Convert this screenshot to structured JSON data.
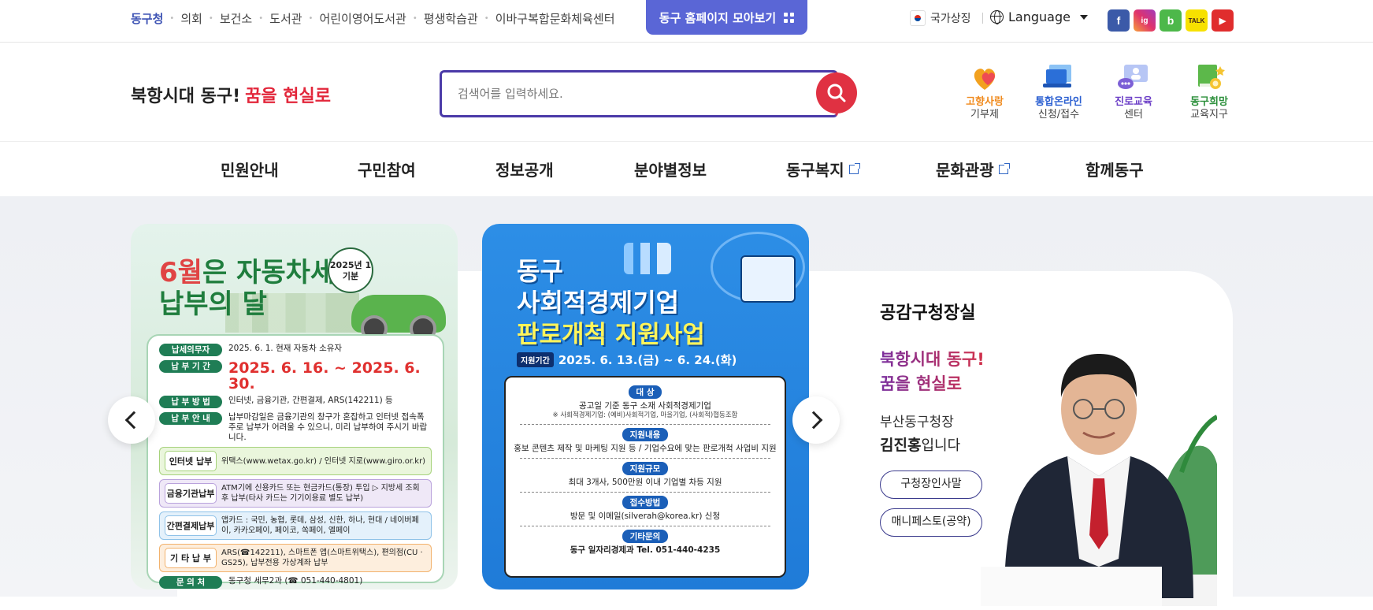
{
  "topbar": {
    "links": [
      "동구청",
      "의회",
      "보건소",
      "도서관",
      "어린이영어도서관",
      "평생학습관",
      "이바구복합문화체육센터"
    ],
    "all_sites_button": "동구 홈페이지 모아보기",
    "national_symbol": "국가상징",
    "language": "Language",
    "social": [
      "f",
      "ig",
      "b",
      "TALK",
      "▶"
    ]
  },
  "header": {
    "slogan_black": "북항시대 동구!",
    "slogan_red": "꿈을 현실로",
    "search_placeholder": "검색어를 입력하세요.",
    "quick_links": [
      {
        "title": "고향사랑",
        "sub": "기부제",
        "color": "#f08a1d"
      },
      {
        "title": "통합온라인",
        "sub": "신청/접수",
        "color": "#2b5fd1"
      },
      {
        "title": "진로교육",
        "sub": "센터",
        "color": "#6c3fc7"
      },
      {
        "title": "동구희망",
        "sub": "교육지구",
        "color": "#2b8f3a"
      }
    ]
  },
  "gnb": [
    "민원안내",
    "구민참여",
    "정보공개",
    "분야별정보",
    "동구복지",
    "문화관광",
    "함께동구"
  ],
  "slider": {
    "poster1": {
      "badge": "2025년 1기분",
      "title_red": "6월",
      "title_rest": "은 자동차세",
      "title_line2": "납부의 달",
      "rows": [
        {
          "label": "납세의무자",
          "text": "2025. 6. 1. 현재 자동차 소유자"
        },
        {
          "label": "납 부 기 간",
          "text": "2025. 6. 16. ~ 2025. 6. 30."
        },
        {
          "label": "납 부 방 법",
          "text": "인터넷, 금융기관, 간편결제, ARS(142211) 등"
        },
        {
          "label": "납 부 안 내",
          "text": "납부마감일은 금융기관의 창구가 혼잡하고 인터넷 접속폭주로 납부가 어려울 수 있으니, 미리 납부하여 주시기 바랍니다."
        }
      ],
      "subs": [
        {
          "tag": "인터넷 납부",
          "text": "위택스(www.wetax.go.kr) / 인터넷 지로(www.giro.or.kr)",
          "bg": "#eaf6dc",
          "border": "#a6d27b"
        },
        {
          "tag": "금융기관납부",
          "text": "ATM기에 신용카드 또는 현금카드(통장) 투입 ▷ 지방세 조회 후 납부(타사 카드는 기기이용료 별도 납부)",
          "bg": "#efe8f7",
          "border": "#b9a2dc"
        },
        {
          "tag": "간편결제납부",
          "text": "앱카드 : 국민, 농협, 롯데, 삼성, 신한, 하나, 현대 / 네이버페이, 카카오페이, 페이코, 쏙페이, 엘페이",
          "bg": "#e4f1fb",
          "border": "#8fc2e8"
        },
        {
          "tag": "기 타 납 부",
          "text": "ARS(☎142211), 스마트폰 앱(스마트위택스), 편의점(CU · GS25), 납부전용 가상계좌 납부",
          "bg": "#fdeedd",
          "border": "#f2b26d"
        }
      ],
      "contact_label": "문 의 처",
      "contact_text": "동구청 세무2과 (☎ 051-440-4801)"
    },
    "poster2": {
      "title_line1": "동구",
      "title_line2": "사회적경제기업",
      "title_line3": "판로개척 지원사업",
      "period_label": "지원기간",
      "period": "2025. 6. 13.(금) ~ 6. 24.(화)",
      "sections": [
        {
          "tag": "대 상",
          "text": "공고일 기준 동구 소재 사회적경제기업",
          "small": "※ 사회적경제기업: (예비)사회적기업, 마을기업, (사회적)협동조합"
        },
        {
          "tag": "지원내용",
          "text": "홍보 콘텐츠 제작 및 마케팅 지원 등 / 기업수요에 맞는 판로개척 사업비 지원",
          "small": ""
        },
        {
          "tag": "지원규모",
          "text": "최대 3개사, 500만원 이내 기업별 차등 지원",
          "small": ""
        },
        {
          "tag": "접수방법",
          "text": "방문 및 이메일(silverah@korea.kr) 신청",
          "small": ""
        },
        {
          "tag": "기타문의",
          "text": "동구 일자리경제과 Tel. 051-440-4235",
          "small": ""
        }
      ]
    }
  },
  "mayor": {
    "title": "공감구청장실",
    "slogan_line1": "북항시대 동구!",
    "slogan_line2": "꿈을 현실로",
    "role": "부산동구청장",
    "name": "김진홍",
    "name_suffix": "입니다",
    "button1": "구청장인사말",
    "button2": "매니페스토(공약)"
  }
}
